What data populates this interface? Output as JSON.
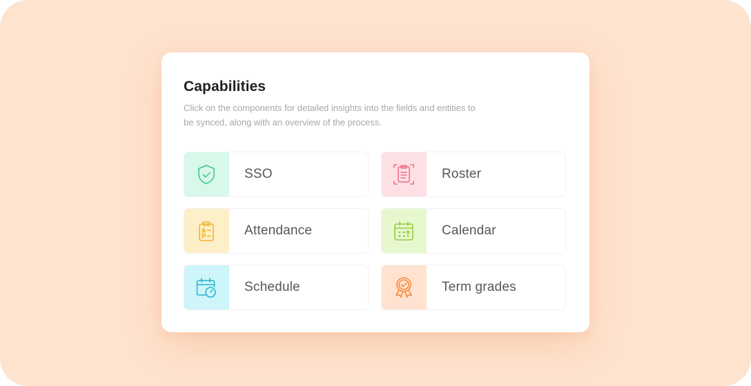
{
  "card": {
    "title": "Capabilities",
    "subtitle": "Click on the components for detailed insights into the fields and entities to be synced, along with an overview of the process."
  },
  "capabilities": [
    {
      "label": "SSO",
      "icon": "shield-check-icon",
      "bg": "#d8f8ea",
      "color": "#3ec69a"
    },
    {
      "label": "Roster",
      "icon": "clipboard-list-icon",
      "bg": "#fde0e4",
      "color": "#ef6f86"
    },
    {
      "label": "Attendance",
      "icon": "attendance-clipboard-icon",
      "bg": "#fdefc7",
      "color": "#f3b52c"
    },
    {
      "label": "Calendar",
      "icon": "calendar-icon",
      "bg": "#e7f8cf",
      "color": "#8fcf3a"
    },
    {
      "label": "Schedule",
      "icon": "calendar-clock-icon",
      "bg": "#cdf5fa",
      "color": "#23b6cb"
    },
    {
      "label": "Term grades",
      "icon": "award-badge-icon",
      "bg": "#ffe2cf",
      "color": "#f48a3c"
    }
  ]
}
